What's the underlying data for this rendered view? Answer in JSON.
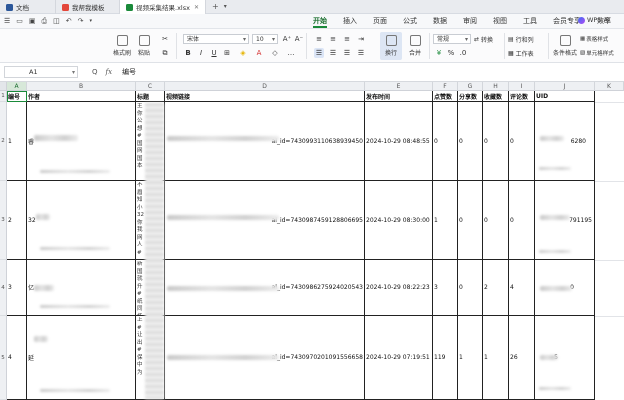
{
  "tabs": [
    {
      "label": "文档",
      "icon": "home-icon",
      "color": "#2b579a"
    },
    {
      "label": "我帮我模板",
      "icon": "template-icon",
      "color": "#e3463a"
    },
    {
      "label": "视频采集结果.xlsx",
      "icon": "sheet-icon",
      "color": "#1a8a3a"
    }
  ],
  "tabbar": {
    "new_tab": "+",
    "more": "▾"
  },
  "menu": {
    "items": [
      "开始",
      "插入",
      "页面",
      "公式",
      "数据",
      "审阅",
      "视图",
      "工具",
      "会员专享",
      "效率"
    ],
    "active": "开始",
    "ai_label": "WPS AI"
  },
  "ribbon": {
    "format_painter": "格式刷",
    "paste": "粘贴",
    "font_name": "宋体",
    "font_size": "10",
    "wrap": "换行",
    "merge": "合并",
    "number_format": "常规",
    "convert": "转换",
    "rows_cols": "行和列",
    "worksheet": "工作表",
    "cond_format": "条件格式",
    "table_style": "表格样式",
    "cell_style": "单元格样式"
  },
  "formula_bar": {
    "cell_ref": "A1",
    "zoom_icon": "Q",
    "fx": "fx",
    "content": "编号"
  },
  "columns": [
    "A",
    "B",
    "C",
    "D",
    "E",
    "F",
    "G",
    "H",
    "I",
    "J",
    "K"
  ],
  "headers": [
    "编号",
    "作者",
    "标题",
    "视频链接",
    "发布时间",
    "点赞数",
    "分享数",
    "收藏数",
    "评论数",
    "UID"
  ],
  "row_numbers": [
    "1",
    "2",
    "3",
    "4",
    "5"
  ],
  "rows": [
    {
      "id": "1",
      "author": "睿",
      "link_suffix": "al_id=7430993110638939450",
      "time": "2024-10-29 08:48:55",
      "likes": "0",
      "shares": "0",
      "favs": "0",
      "comments": "0",
      "uid_suffix": "6280"
    },
    {
      "id": "2",
      "author": "32",
      "link_suffix": "al_id=7430987459128806695",
      "time": "2024-10-29 08:30:00",
      "likes": "1",
      "shares": "0",
      "favs": "0",
      "comments": "0",
      "uid_suffix": "791195"
    },
    {
      "id": "3",
      "author": "亿",
      "link_suffix": "al_id=7430986275924020543",
      "time": "2024-10-29 08:22:23",
      "likes": "3",
      "shares": "0",
      "favs": "2",
      "comments": "4",
      "uid_suffix": "0"
    },
    {
      "id": "4",
      "author": "延",
      "link_suffix": "al_id=7430970201091556658",
      "time": "2024-10-29 07:19:51",
      "likes": "119",
      "shares": "1",
      "favs": "1",
      "comments": "26",
      "uid_suffix": "5"
    }
  ],
  "title_snippets": [
    "主\n你\n公\n想\n#\n国\n网\n国\n本",
    "不\n眉\n知\n小\n32\n你\n我\n网\n人\n#",
    "新\n国\n就\n升\n#\n纸\n同\n杨",
    "上\n#\n让\n出\n#\n保\n中\n为"
  ]
}
